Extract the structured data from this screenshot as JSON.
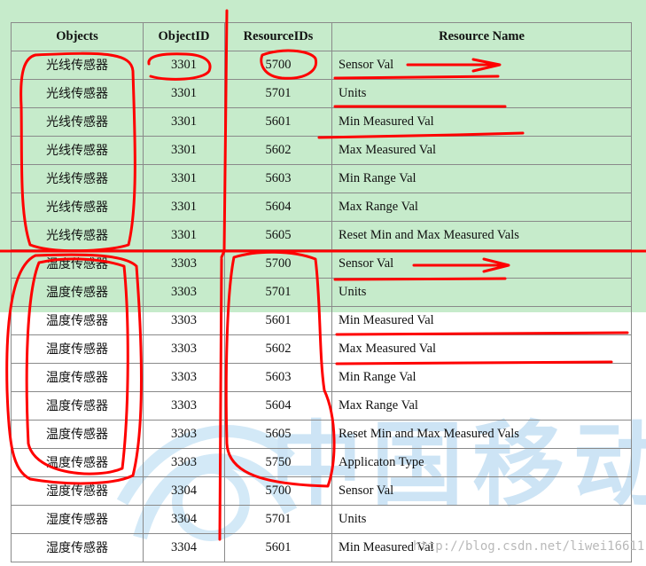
{
  "table": {
    "headers": [
      "Objects",
      "ObjectID",
      "ResourceIDs",
      "Resource Name"
    ],
    "rows": [
      [
        "光线传感器",
        "3301",
        "5700",
        "Sensor Val"
      ],
      [
        "光线传感器",
        "3301",
        "5701",
        "Units"
      ],
      [
        "光线传感器",
        "3301",
        "5601",
        "Min Measured Val"
      ],
      [
        "光线传感器",
        "3301",
        "5602",
        "Max Measured Val"
      ],
      [
        "光线传感器",
        "3301",
        "5603",
        "Min Range Val"
      ],
      [
        "光线传感器",
        "3301",
        "5604",
        "Max Range Val"
      ],
      [
        "光线传感器",
        "3301",
        "5605",
        "Reset Min and Max Measured Vals"
      ],
      [
        "温度传感器",
        "3303",
        "5700",
        "Sensor Val"
      ],
      [
        "温度传感器",
        "3303",
        "5701",
        "Units"
      ],
      [
        "温度传感器",
        "3303",
        "5601",
        "Min Measured Val"
      ],
      [
        "温度传感器",
        "3303",
        "5602",
        "Max Measured Val"
      ],
      [
        "温度传感器",
        "3303",
        "5603",
        "Min Range Val"
      ],
      [
        "温度传感器",
        "3303",
        "5604",
        "Max Range Val"
      ],
      [
        "温度传感器",
        "3303",
        "5605",
        "Reset Min and Max Measured Vals"
      ],
      [
        "温度传感器",
        "3303",
        "5750",
        "Applicaton Type"
      ],
      [
        "湿度传感器",
        "3304",
        "5700",
        "Sensor Val"
      ],
      [
        "湿度传感器",
        "3304",
        "5701",
        "Units"
      ],
      [
        "湿度传感器",
        "3304",
        "5601",
        "Min Measured Val"
      ]
    ]
  },
  "watermark": {
    "glyphs": "中国移动",
    "footer_text": "http://blog.csdn.net/liwei16611"
  },
  "colors": {
    "green_band": "#c6ebcb",
    "annotation_red": "#ff0000",
    "watermark_blue": "#cde4f5"
  }
}
